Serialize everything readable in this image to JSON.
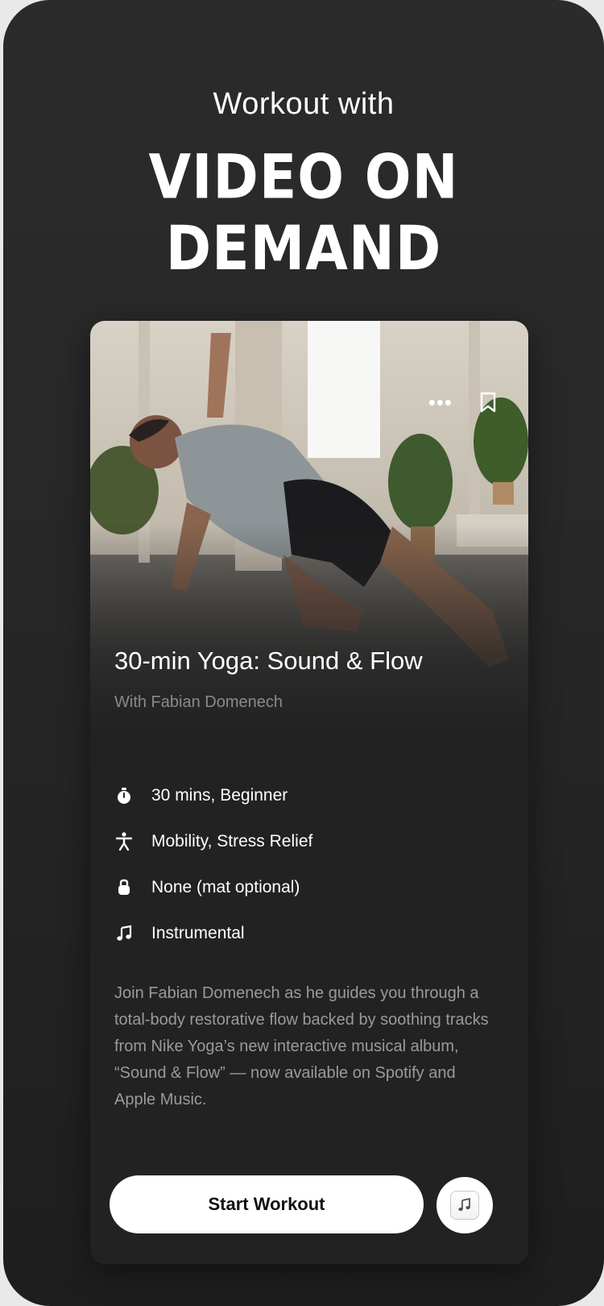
{
  "header": {
    "subtitle": "Workout with",
    "title": "VIDEO ON DEMAND"
  },
  "card": {
    "title": "30-min Yoga: Sound & Flow",
    "instructor": "With Fabian Domenech",
    "details": [
      {
        "icon": "stopwatch-icon",
        "text": "30 mins, Beginner"
      },
      {
        "icon": "person-icon",
        "text": "Mobility, Stress Relief"
      },
      {
        "icon": "kettlebell-icon",
        "text": "None (mat optional)"
      },
      {
        "icon": "music-note-icon",
        "text": "Instrumental"
      }
    ],
    "description": "Join Fabian Domenech as he guides you through a total-body restorative flow backed by soothing tracks from Nike Yoga’s new interactive musical album, “Sound & Flow” — now available on Spotify and Apple Music.",
    "actions": {
      "more": "•••",
      "start_label": "Start Workout"
    }
  },
  "colors": {
    "background": "#272727",
    "card": "#222222",
    "accent": "#ffffff",
    "muted_text": "#8a8a8a"
  }
}
